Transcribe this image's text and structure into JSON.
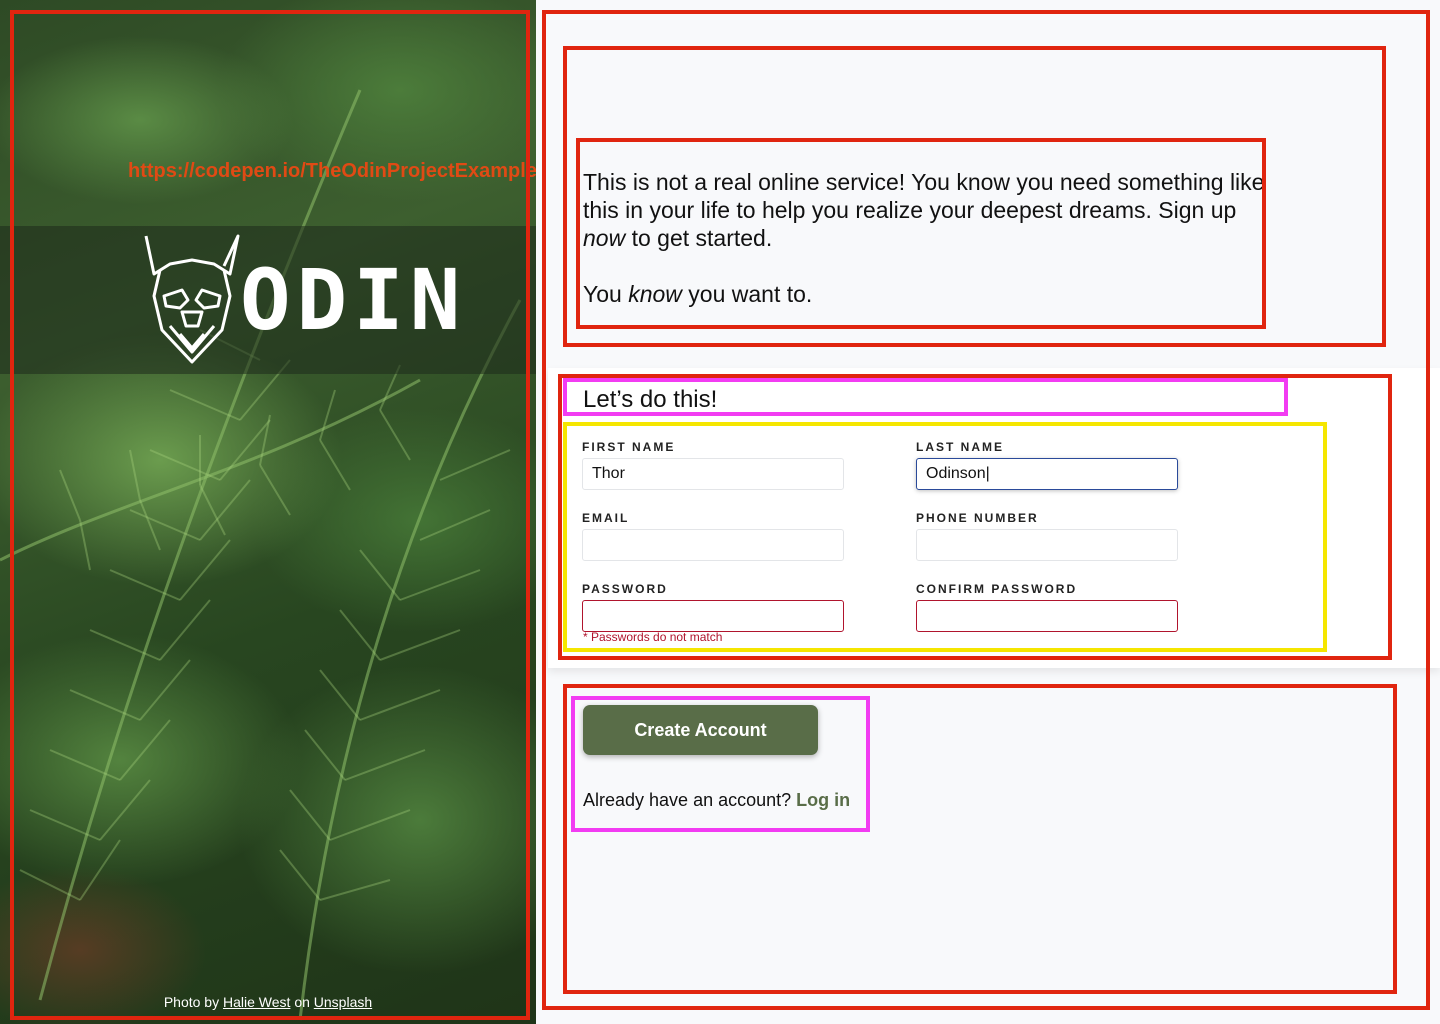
{
  "hero": {
    "url_text": "https://codepen.io/TheOdinProjectExamples/pen/poWyWeJ",
    "logo_word": "ODIN",
    "credit_prefix": "Photo by",
    "credit_author": "Halie West",
    "credit_middle": "on",
    "credit_site": "Unsplash"
  },
  "intro": {
    "line1_a": "This is not a real online service! You know you need something like this in your life to help you realize your deepest dreams. Sign up ",
    "line1_em": "now",
    "line1_b": " to get started.",
    "line2_a": "You ",
    "line2_em": "know",
    "line2_b": " you want to."
  },
  "form": {
    "heading": "Let’s do this!",
    "fields": {
      "first_name": {
        "label": "FIRST NAME",
        "value": "Thor"
      },
      "last_name": {
        "label": "LAST NAME",
        "value": "Odinson|"
      },
      "email": {
        "label": "EMAIL",
        "value": ""
      },
      "phone": {
        "label": "PHONE NUMBER",
        "value": ""
      },
      "password": {
        "label": "PASSWORD",
        "value": ""
      },
      "confirm_password": {
        "label": "CONFIRM PASSWORD",
        "value": ""
      }
    },
    "error": "* Passwords do not match"
  },
  "actions": {
    "create_label": "Create Account",
    "login_prompt": "Already have an account?",
    "login_link": "Log in"
  },
  "colors": {
    "accent": "#596d48",
    "error": "#b0142d",
    "focus": "#2a4a9a",
    "annotation_red": "#e0250f",
    "annotation_magenta": "#f23cf2",
    "annotation_yellow": "#f5e600"
  },
  "icons": {
    "logo": "odin-viking-head-icon"
  }
}
